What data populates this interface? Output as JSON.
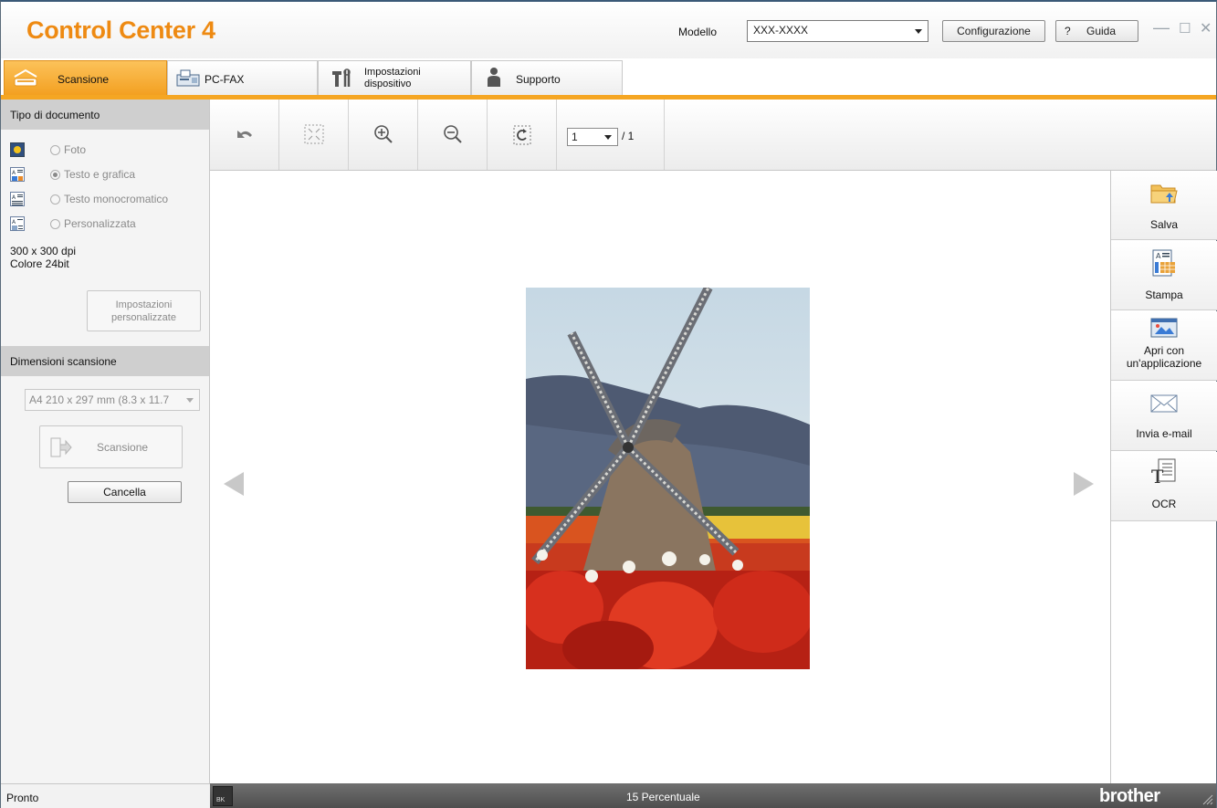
{
  "titlebar": {
    "logo_text": "Control Center 4",
    "model_label": "Modello",
    "model_value": "XXX-XXXX",
    "config_button": "Configurazione",
    "help_icon_glyph": "?",
    "help_button": "Guida",
    "minimize_glyph": "—",
    "maximize_glyph": "☐",
    "close_glyph": "✕"
  },
  "tabs": [
    {
      "label": "Scansione",
      "icon": "scanner-icon",
      "active": true
    },
    {
      "label": "PC-FAX",
      "icon": "fax-icon",
      "active": false
    },
    {
      "label_line1": "Impostazioni",
      "label_line2": "dispositivo",
      "icon": "tools-icon",
      "active": false
    },
    {
      "label": "Supporto",
      "icon": "person-icon",
      "active": false
    }
  ],
  "left_panel": {
    "doc_type_heading": "Tipo di documento",
    "doc_types": [
      {
        "label": "Foto",
        "selected": false
      },
      {
        "label": "Testo e grafica",
        "selected": true
      },
      {
        "label": "Testo monocromatico",
        "selected": false
      },
      {
        "label": "Personalizzata",
        "selected": false
      }
    ],
    "resolution": "300 x 300 dpi",
    "color": "Colore 24bit",
    "custom_settings_line1": "Impostazioni",
    "custom_settings_line2": "personalizzate",
    "scan_size_heading": "Dimensioni scansione",
    "scan_size_value": "A4 210 x 297 mm (8.3 x 11.7",
    "scan_button": "Scansione",
    "cancel_button": "Cancella"
  },
  "toolbar": {
    "page_value": "1",
    "page_total": "/ 1",
    "buttons": [
      "undo-icon",
      "fit-page-icon",
      "zoom-in-icon",
      "zoom-out-icon",
      "rotate-icon"
    ]
  },
  "actions": [
    {
      "label": "Salva",
      "icon": "folder-save-icon"
    },
    {
      "label": "Stampa",
      "icon": "print-icon"
    },
    {
      "label_line1": "Apri con",
      "label_line2": "un'applicazione",
      "icon": "open-app-icon"
    },
    {
      "label": "Invia e-mail",
      "icon": "envelope-icon"
    },
    {
      "label": "OCR",
      "icon": "ocr-icon"
    }
  ],
  "status": {
    "left_text": "Pronto",
    "ink_label": "BK",
    "zoom_text": "15 Percentuale",
    "brand": "brother"
  },
  "colors": {
    "accent_orange": "#f5a623",
    "logo_orange": "#ee8a12",
    "status_bar": "#5a5a5a"
  }
}
